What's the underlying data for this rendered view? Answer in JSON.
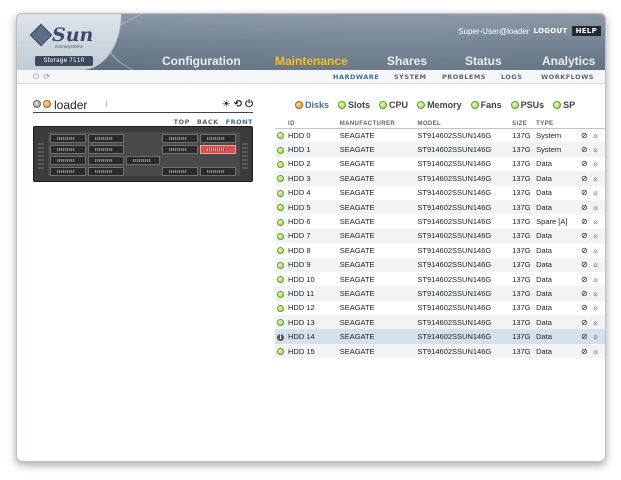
{
  "brand": {
    "logo_text": "Sun",
    "logo_sub": "microsystems",
    "product": "Storage 7110"
  },
  "header": {
    "user": "Super-User@loader",
    "logout": "LOGOUT",
    "help": "HELP"
  },
  "main_tabs": [
    {
      "label": "Configuration",
      "active": false
    },
    {
      "label": "Maintenance",
      "active": true
    },
    {
      "label": "Shares",
      "active": false
    },
    {
      "label": "Status",
      "active": false
    },
    {
      "label": "Analytics",
      "active": false
    }
  ],
  "subnav": [
    "HARDWARE",
    "SYSTEM",
    "PROBLEMS",
    "LOGS",
    "WORKFLOWS"
  ],
  "subnav_active": "HARDWARE",
  "system": {
    "name": "loader"
  },
  "views": {
    "top": "TOP",
    "back": "BACK",
    "front": "FRONT",
    "active": "FRONT"
  },
  "categories": [
    {
      "label": "Disks",
      "status": "warning",
      "active": true
    },
    {
      "label": "Slots",
      "status": "ok",
      "active": false
    },
    {
      "label": "CPU",
      "status": "ok",
      "active": false
    },
    {
      "label": "Memory",
      "status": "ok",
      "active": false
    },
    {
      "label": "Fans",
      "status": "ok",
      "active": false
    },
    {
      "label": "PSUs",
      "status": "ok",
      "active": false
    },
    {
      "label": "SP",
      "status": "ok",
      "active": false
    }
  ],
  "table": {
    "columns": [
      "ID",
      "MANUFACTURER",
      "MODEL",
      "SIZE",
      "TYPE"
    ],
    "rows": [
      {
        "id": "HDD 0",
        "manufacturer": "SEAGATE",
        "model": "ST914602SSUN146G",
        "size": "137G",
        "type": "System",
        "status": "ok"
      },
      {
        "id": "HDD 1",
        "manufacturer": "SEAGATE",
        "model": "ST914602SSUN146G",
        "size": "137G",
        "type": "System",
        "status": "ok"
      },
      {
        "id": "HDD 2",
        "manufacturer": "SEAGATE",
        "model": "ST914602SSUN146G",
        "size": "137G",
        "type": "Data",
        "status": "ok"
      },
      {
        "id": "HDD 3",
        "manufacturer": "SEAGATE",
        "model": "ST914602SSUN146G",
        "size": "137G",
        "type": "Data",
        "status": "ok"
      },
      {
        "id": "HDD 4",
        "manufacturer": "SEAGATE",
        "model": "ST914602SSUN146G",
        "size": "137G",
        "type": "Data",
        "status": "ok"
      },
      {
        "id": "HDD 5",
        "manufacturer": "SEAGATE",
        "model": "ST914602SSUN146G",
        "size": "137G",
        "type": "Data",
        "status": "ok"
      },
      {
        "id": "HDD 6",
        "manufacturer": "SEAGATE",
        "model": "ST914602SSUN146G",
        "size": "137G",
        "type": "Spare [A]",
        "status": "ok"
      },
      {
        "id": "HDD 7",
        "manufacturer": "SEAGATE",
        "model": "ST914602SSUN146G",
        "size": "137G",
        "type": "Data",
        "status": "ok"
      },
      {
        "id": "HDD 8",
        "manufacturer": "SEAGATE",
        "model": "ST914602SSUN146G",
        "size": "137G",
        "type": "Data",
        "status": "ok"
      },
      {
        "id": "HDD 9",
        "manufacturer": "SEAGATE",
        "model": "ST914602SSUN146G",
        "size": "137G",
        "type": "Data",
        "status": "ok"
      },
      {
        "id": "HDD 10",
        "manufacturer": "SEAGATE",
        "model": "ST914602SSUN146G",
        "size": "137G",
        "type": "Data",
        "status": "ok"
      },
      {
        "id": "HDD 11",
        "manufacturer": "SEAGATE",
        "model": "ST914602SSUN146G",
        "size": "137G",
        "type": "Data",
        "status": "ok"
      },
      {
        "id": "HDD 12",
        "manufacturer": "SEAGATE",
        "model": "ST914602SSUN146G",
        "size": "137G",
        "type": "Data",
        "status": "ok"
      },
      {
        "id": "HDD 13",
        "manufacturer": "SEAGATE",
        "model": "ST914602SSUN146G",
        "size": "137G",
        "type": "Data",
        "status": "ok"
      },
      {
        "id": "HDD 14",
        "manufacturer": "SEAGATE",
        "model": "ST914602SSUN146G",
        "size": "137G",
        "type": "Data",
        "status": "info",
        "selected": true
      },
      {
        "id": "HDD 15",
        "manufacturer": "SEAGATE",
        "model": "ST914602SSUN146G",
        "size": "137G",
        "type": "Data",
        "status": "ok"
      }
    ]
  },
  "colors": {
    "accent": "#f4c01a",
    "link_active": "#3d6fa3",
    "ok": "#5eb519",
    "warning": "#ee8a16",
    "selected_bay": "#d95252"
  }
}
